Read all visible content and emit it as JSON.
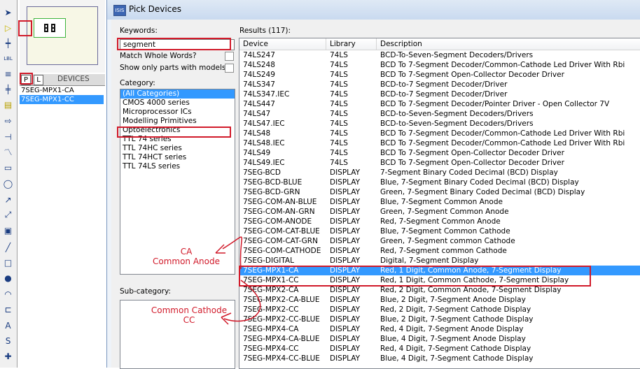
{
  "toolbar": {
    "tools": [
      {
        "icon": "arrow-pointer-icon"
      },
      {
        "icon": "component-mode-icon"
      },
      {
        "icon": "junction-dot-icon"
      },
      {
        "icon": "wire-label-icon"
      },
      {
        "icon": "text-script-icon"
      },
      {
        "icon": "bus-icon"
      },
      {
        "icon": "subcircuit-icon"
      },
      {
        "icon": "terminal-icon"
      },
      {
        "icon": "device-pin-icon"
      },
      {
        "icon": "graph-icon"
      },
      {
        "icon": "tape-recorder-icon"
      },
      {
        "icon": "generator-icon"
      },
      {
        "icon": "voltage-probe-icon"
      },
      {
        "icon": "current-probe-icon"
      },
      {
        "icon": "virtual-instrument-icon"
      },
      {
        "icon": "line-icon"
      },
      {
        "icon": "box-icon"
      },
      {
        "icon": "circle-icon"
      },
      {
        "icon": "arc-icon"
      },
      {
        "icon": "path-icon"
      },
      {
        "icon": "text-icon"
      },
      {
        "icon": "symbol-icon"
      },
      {
        "icon": "marker-icon"
      }
    ]
  },
  "device_panel": {
    "tab_p": "P",
    "tab_l": "L",
    "header": "DEVICES",
    "items": [
      "7SEG-MPX1-CA",
      "7SEG-MPX1-CC"
    ]
  },
  "dialog": {
    "title": "Pick Devices",
    "keywords_label": "Keywords:",
    "keywords_value": "segment",
    "match_whole_words": "Match Whole Words?",
    "show_only_models": "Show only parts with models?",
    "category_label": "Category:",
    "categories": [
      "(All Categories)",
      "CMOS 4000 series",
      "Microprocessor ICs",
      "Modelling Primitives",
      "Optoelectronics",
      "TTL 74 series",
      "TTL 74HC series",
      "TTL 74HCT series",
      "TTL 74LS series"
    ],
    "subcategory_label": "Sub-category:",
    "results_label": "Results (117):",
    "columns": [
      "Device",
      "Library",
      "Description"
    ],
    "rows": [
      [
        "74LS247",
        "74LS",
        "BCD-To-Seven-Segment Decoders/Drivers"
      ],
      [
        "74LS248",
        "74LS",
        "BCD To 7-Segment Decoder/Common-Cathode Led Driver With Rbi"
      ],
      [
        "74LS249",
        "74LS",
        "BCD To 7-Segment Open-Collector Decoder Driver"
      ],
      [
        "74LS347",
        "74LS",
        "BCD-to-7 Segment Decoder/Driver"
      ],
      [
        "74LS347.IEC",
        "74LS",
        "BCD-to-7 Segment Decoder/Driver"
      ],
      [
        "74LS447",
        "74LS",
        "BCD To 7-Segment Decoder/Pointer Driver - Open Collector 7V"
      ],
      [
        "74LS47",
        "74LS",
        "BCD-to-Seven-Segment Decoders/Drivers"
      ],
      [
        "74LS47.IEC",
        "74LS",
        "BCD-to-Seven-Segment Decoders/Drivers"
      ],
      [
        "74LS48",
        "74LS",
        "BCD To 7-Segment Decoder/Common-Cathode Led Driver With Rbi"
      ],
      [
        "74LS48.IEC",
        "74LS",
        "BCD To 7-Segment Decoder/Common-Cathode Led Driver With Rbi"
      ],
      [
        "74LS49",
        "74LS",
        "BCD To 7-Segment Open-Collector Decoder Driver"
      ],
      [
        "74LS49.IEC",
        "74LS",
        "BCD To 7-Segment Open-Collector Decoder Driver"
      ],
      [
        "7SEG-BCD",
        "DISPLAY",
        "7-Segment Binary Coded Decimal (BCD) Display"
      ],
      [
        "7SEG-BCD-BLUE",
        "DISPLAY",
        "Blue,  7-Segment Binary Coded Decimal (BCD) Display"
      ],
      [
        "7SEG-BCD-GRN",
        "DISPLAY",
        "Green, 7-Segment Binary Coded Decimal (BCD) Display"
      ],
      [
        "7SEG-COM-AN-BLUE",
        "DISPLAY",
        "Blue, 7-Segment Common Anode"
      ],
      [
        "7SEG-COM-AN-GRN",
        "DISPLAY",
        "Green, 7-Segment Common Anode"
      ],
      [
        "7SEG-COM-ANODE",
        "DISPLAY",
        "Red, 7-Segment Common Anode"
      ],
      [
        "7SEG-COM-CAT-BLUE",
        "DISPLAY",
        "Blue, 7-Segment Common Cathode"
      ],
      [
        "7SEG-COM-CAT-GRN",
        "DISPLAY",
        "Green, 7-Segment common Cathode"
      ],
      [
        "7SEG-COM-CATHODE",
        "DISPLAY",
        "Red, 7-Segment common Cathode"
      ],
      [
        "7SEG-DIGITAL",
        "DISPLAY",
        "Digital, 7-Segment Display"
      ],
      [
        "7SEG-MPX1-CA",
        "DISPLAY",
        "Red, 1 Digit, Common Anode, 7-Segment Display"
      ],
      [
        "7SEG-MPX1-CC",
        "DISPLAY",
        "Red, 1 Digit, Common Cathode, 7-Segment Display"
      ],
      [
        "7SEG-MPX2-CA",
        "DISPLAY",
        "Red, 2 Digit, Common Anode, 7-Segment Display"
      ],
      [
        "7SEG-MPX2-CA-BLUE",
        "DISPLAY",
        "Blue, 2 Digit, 7-Segment Anode Display"
      ],
      [
        "7SEG-MPX2-CC",
        "DISPLAY",
        "Red, 2 Digit, 7-Segment Cathode Display"
      ],
      [
        "7SEG-MPX2-CC-BLUE",
        "DISPLAY",
        "Blue, 2 Digit, 7-Segment Cathode Display"
      ],
      [
        "7SEG-MPX4-CA",
        "DISPLAY",
        "Red, 4 Digit, 7-Segment Anode Display"
      ],
      [
        "7SEG-MPX4-CA-BLUE",
        "DISPLAY",
        "Blue, 4 Digit, 7-Segment Anode Display"
      ],
      [
        "7SEG-MPX4-CC",
        "DISPLAY",
        "Red, 4 Digit, 7-Segment Cathode Display"
      ],
      [
        "7SEG-MPX4-CC-BLUE",
        "DISPLAY",
        "Blue, 4 Digit, 7-Segment Cathode Display"
      ]
    ],
    "selected_row": "7SEG-MPX1-CA"
  },
  "annotations": {
    "ca_line1": "CA",
    "ca_line2": "Common Anode",
    "cc_line1": "Common Cathode",
    "cc_line2": "CC",
    "color": "#d11a2a"
  },
  "colors": {
    "selection": "#3399ff",
    "annotation": "#d11a2a"
  }
}
